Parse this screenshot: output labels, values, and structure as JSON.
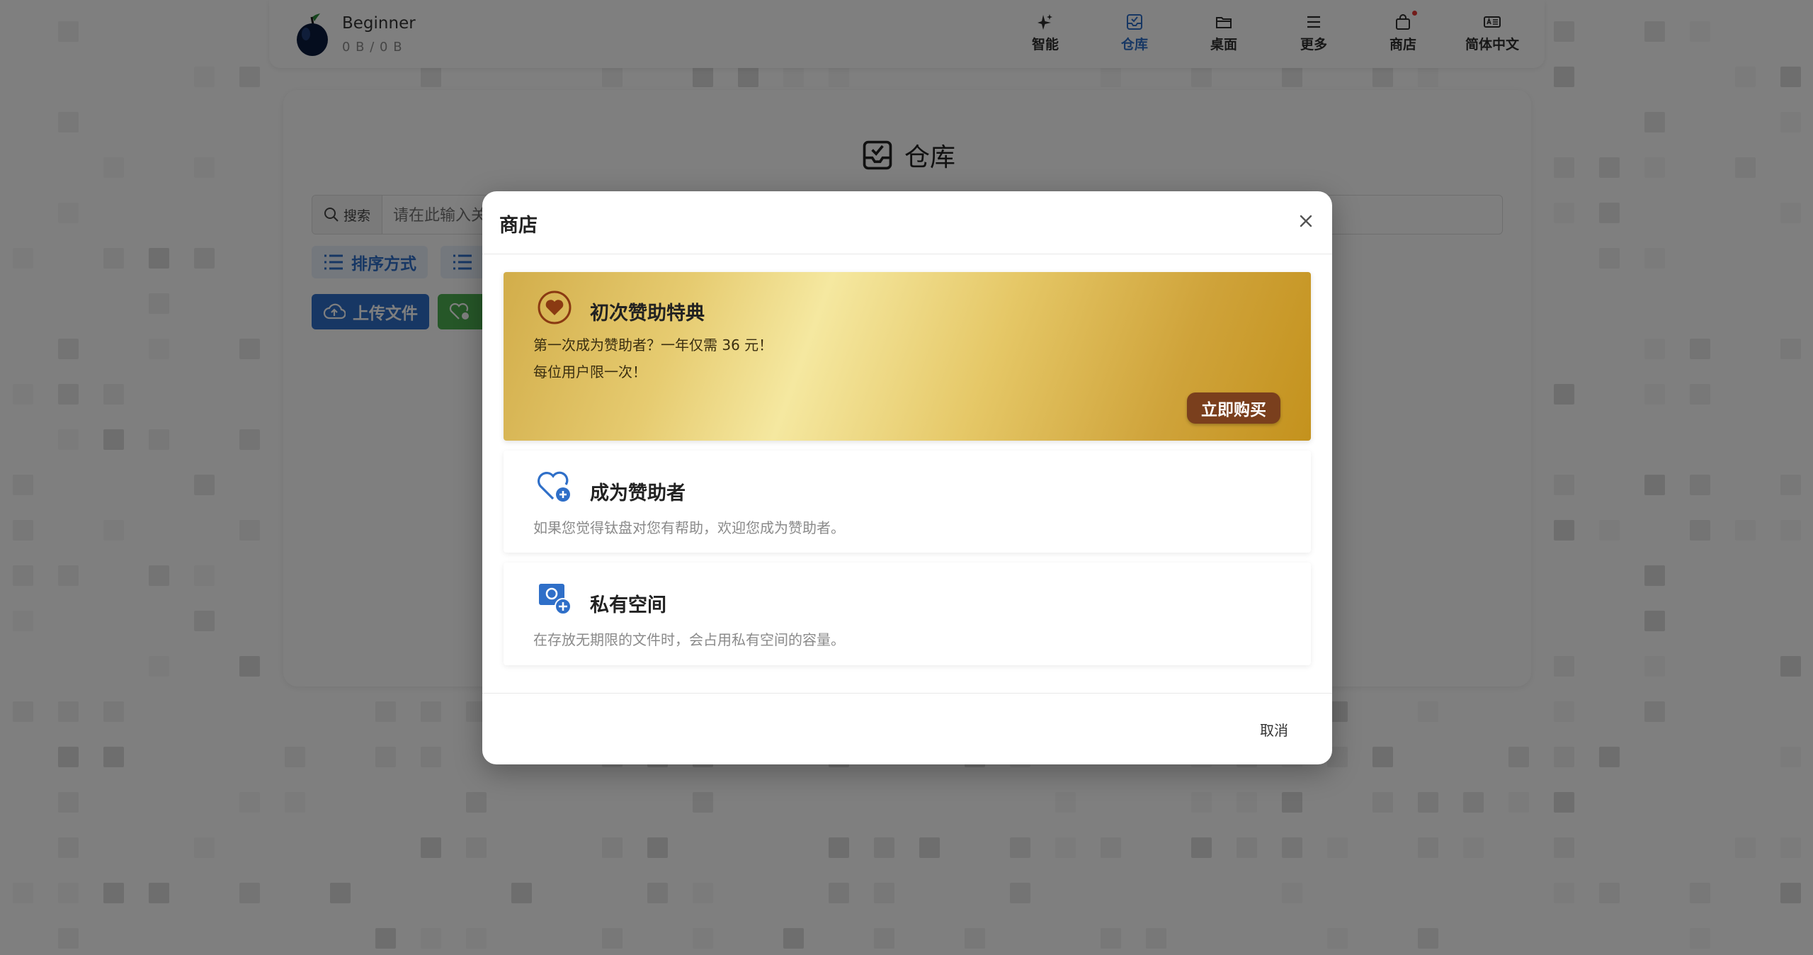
{
  "user": {
    "name": "Beginner",
    "quota": "0 B / 0 B"
  },
  "nav": {
    "items": [
      {
        "label": "智能",
        "icon": "sparkle-icon"
      },
      {
        "label": "仓库",
        "icon": "inbox-icon",
        "active": true
      },
      {
        "label": "桌面",
        "icon": "folder-icon"
      },
      {
        "label": "更多",
        "icon": "menu-icon"
      },
      {
        "label": "商店",
        "icon": "shopping-bag-icon",
        "badge": true
      },
      {
        "label": "简体中文",
        "icon": "language-icon"
      }
    ]
  },
  "page": {
    "title": "仓库",
    "search_label": "搜索",
    "search_placeholder": "请在此输入关键字",
    "sort_label": "排序方式",
    "upload_label": "上传文件"
  },
  "modal": {
    "title": "商店",
    "cancel_label": "取消",
    "offers": [
      {
        "title": "初次赞助特典",
        "line1": "第一次成为赞助者？一年仅需 36 元！",
        "line2": "每位用户限一次！",
        "button": "立即购买"
      },
      {
        "title": "成为赞助者",
        "desc": "如果您觉得钛盘对您有帮助，欢迎您成为赞助者。"
      },
      {
        "title": "私有空间",
        "desc": "在存放无期限的文件时，会占用私有空间的容量。"
      }
    ]
  },
  "colors": {
    "accent": "#2f6fc8",
    "gold": "#e0bd55",
    "buy_button": "#7a3f1d",
    "green_button": "#4caf50"
  }
}
